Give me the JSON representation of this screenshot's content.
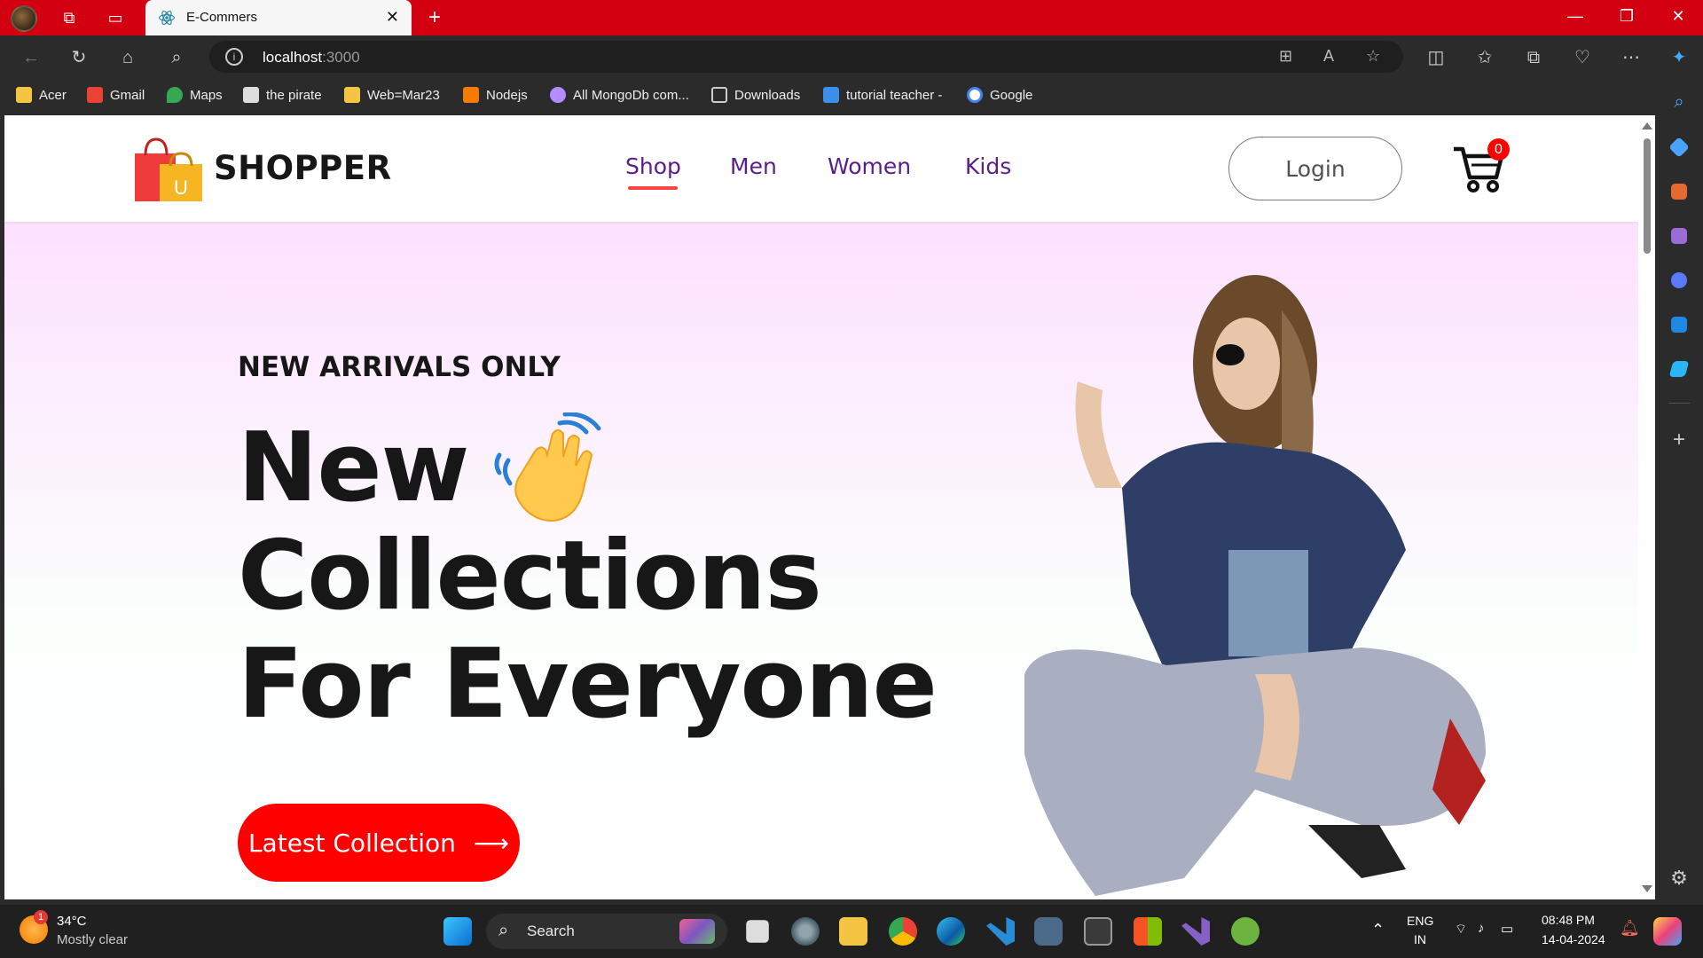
{
  "browser": {
    "tab_title": "E-Commers",
    "url_host": "localhost",
    "url_port": ":3000",
    "bookmarks": [
      {
        "label": "Acer",
        "color": "#f4c542"
      },
      {
        "label": "Gmail",
        "color": "#ea4335"
      },
      {
        "label": "Maps",
        "color": "#34a853"
      },
      {
        "label": "the pirate",
        "color": "#dddddd"
      },
      {
        "label": "Web=Mar23",
        "color": "#f4c542"
      },
      {
        "label": "Nodejs",
        "color": "#f57c00"
      },
      {
        "label": "All MongoDb com...",
        "color": "#b38cff"
      },
      {
        "label": "Downloads",
        "color": "#cccccc"
      },
      {
        "label": "tutorial teacher -",
        "color": "#3b8eea"
      },
      {
        "label": "Google",
        "color": "#ffffff"
      }
    ]
  },
  "site": {
    "brand": "SHOPPER",
    "nav": [
      "Shop",
      "Men",
      "Women",
      "Kids"
    ],
    "active_nav": "Shop",
    "login_label": "Login",
    "cart_count": "0"
  },
  "hero": {
    "kicker": "NEW ARRIVALS ONLY",
    "line1": "New",
    "line2": "Collections",
    "line3": "For Everyone",
    "cta_label": "Latest Collection",
    "cta_arrow": "⟶"
  },
  "taskbar": {
    "weather_temp": "34°C",
    "weather_desc": "Mostly clear",
    "weather_badge": "1",
    "search_label": "Search",
    "lang_line1": "ENG",
    "lang_line2": "IN",
    "time": "08:48 PM",
    "date": "14-04-2024"
  },
  "colors": {
    "browser_accent": "#d20010",
    "brand_red": "#ff0000",
    "nav_purple": "#5a1e8a",
    "hero_pink": "#fde1ff"
  }
}
